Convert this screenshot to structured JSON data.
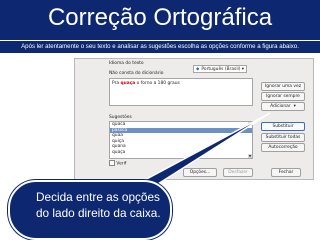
{
  "slide": {
    "title": "Correção Ortográfica",
    "subtitle": "Após ler atentamente o seu texto e analisar as sugestões escolha as opções conforme a figura abaixo."
  },
  "dialog": {
    "language_label": "Idioma do texto",
    "language_value": "Português (Brasil)",
    "dictionary_label": "Não consta do dicionário",
    "text_before": "Pra ",
    "text_error": "quaça",
    "text_after": " o forno a 180 graus",
    "suggestions_label": "Sugestões",
    "suggestions": [
      "quaca",
      "passca",
      "quaa",
      "quiça",
      "quana",
      "quaça"
    ],
    "selected_index": 1,
    "checkbox_label": "Verif",
    "buttons": {
      "ignore_once": "Ignorar uma vez",
      "ignore_all": "Ignorar sempre",
      "add": "Adicionar",
      "replace": "Substituir",
      "replace_all": "Substituir todas",
      "autocorrect": "Autocorreção",
      "options": "Opções...",
      "undo": "Desfazer",
      "close": "Fechar"
    }
  },
  "callout": {
    "text_line1": "Decida entre as opções",
    "text_line2": "do lado direito da caixa."
  },
  "colors": {
    "slide_bg": "#0d2870",
    "selection": "#6b91c6",
    "error_text": "#cc0000"
  }
}
